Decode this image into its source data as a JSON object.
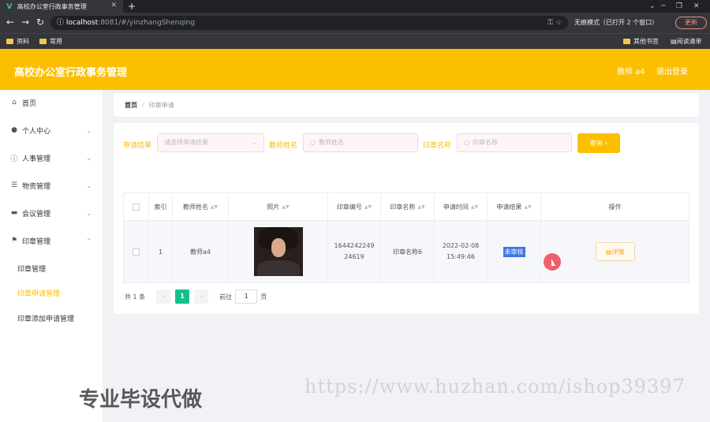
{
  "browser": {
    "tab_title": "高校办公室行政事务管理",
    "url_host": "localhost",
    "url_path": ":8081/#/yinzhangShenqing",
    "incognito": "无痕模式（已打开 2 个窗口）",
    "update_label": "更新",
    "bookmarks": [
      "资料",
      "常用"
    ],
    "other_bookmarks": "其他书签",
    "reading_list": "阅读清单"
  },
  "header": {
    "title": "高校办公室行政事务管理",
    "user": "教师 a4",
    "logout": "退出登录"
  },
  "sidebar": {
    "items": [
      {
        "label": "首页",
        "icon": "home-icon"
      },
      {
        "label": "个人中心",
        "icon": "user-icon"
      },
      {
        "label": "人事管理",
        "icon": "info-icon"
      },
      {
        "label": "物资管理",
        "icon": "list-icon"
      },
      {
        "label": "会议管理",
        "icon": "monitor-icon"
      },
      {
        "label": "印章管理",
        "icon": "flag-icon"
      }
    ],
    "subitems": [
      "印章管理",
      "印章申请管理",
      "印章添加申请管理"
    ]
  },
  "breadcrumb": {
    "home": "首页",
    "sep": "/",
    "current": "印章申请"
  },
  "filters": {
    "result_label": "申请结果",
    "result_placeholder": "请选择申请结果",
    "teacher_label": "教师姓名",
    "teacher_placeholder": "教师姓名",
    "seal_label": "印章名称",
    "seal_placeholder": "印章名称",
    "query_label": "查询"
  },
  "table": {
    "headers": [
      "索引",
      "教师姓名",
      "照片",
      "印章编号",
      "印章名称",
      "申请时间",
      "申请结果",
      "操作"
    ],
    "row": {
      "index": "1",
      "teacher": "教师a4",
      "seal_no_1": "1644242249",
      "seal_no_2": "24619",
      "seal_name": "印章名称6",
      "time_1": "2022-02-08",
      "time_2": "15:49:46",
      "result": "未审核",
      "action": "详情"
    }
  },
  "pager": {
    "total": "共 1 条",
    "prev": "‹",
    "page": "1",
    "next": "›",
    "goto": "前往",
    "input": "1",
    "unit": "页"
  },
  "watermarks": {
    "left": "专业毕设代做",
    "right": "https://www.huzhan.com/ishop39397"
  }
}
